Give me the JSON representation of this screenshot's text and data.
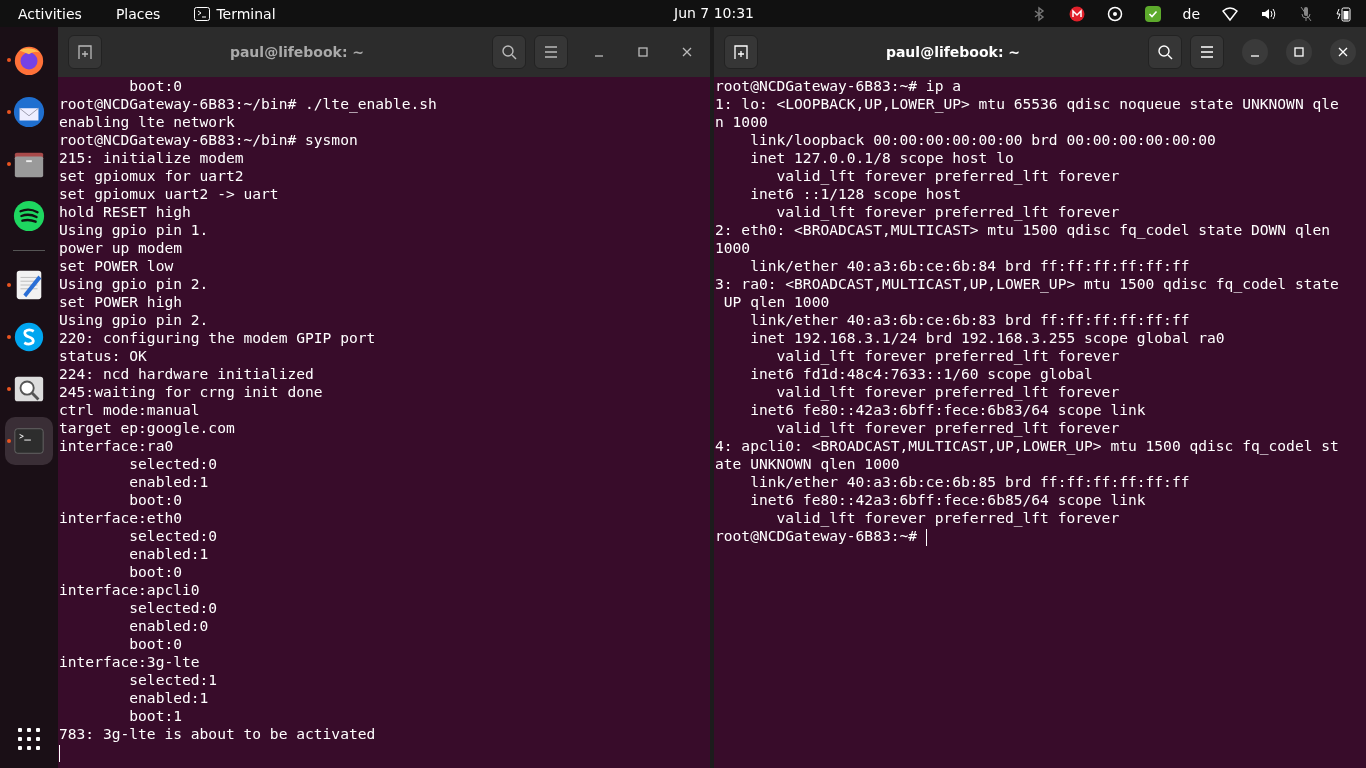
{
  "top_bar": {
    "activities": "Activities",
    "places": "Places",
    "app_menu": "Terminal",
    "clock": "Jun 7  10:31",
    "keyboard_layout": "de"
  },
  "dock": {
    "favorites": [
      {
        "kind": "firefox",
        "running": true,
        "selected": false
      },
      {
        "kind": "thunderbird",
        "running": true,
        "selected": false
      },
      {
        "kind": "files",
        "running": true,
        "selected": false
      },
      {
        "kind": "spotify",
        "running": false,
        "selected": false
      }
    ],
    "others": [
      {
        "kind": "editor",
        "running": true,
        "selected": false
      },
      {
        "kind": "skype",
        "running": true,
        "selected": false
      },
      {
        "kind": "viewer",
        "running": true,
        "selected": false
      },
      {
        "kind": "terminal",
        "running": true,
        "selected": true
      }
    ]
  },
  "windows": [
    {
      "title": "paul@lifebook: ~",
      "focused": false,
      "lines": [
        "        boot:0",
        "root@NCDGateway-6B83:~/bin# ./lte_enable.sh",
        "enabling lte network",
        "root@NCDGateway-6B83:~/bin# sysmon",
        "215: initialize modem",
        "set gpiomux for uart2",
        "set gpiomux uart2 -> uart",
        "hold RESET high",
        "Using gpio pin 1.",
        "power up modem",
        "set POWER low",
        "Using gpio pin 2.",
        "set POWER high",
        "Using gpio pin 2.",
        "220: configuring the modem GPIP port",
        "status: OK",
        "224: ncd hardware initialized",
        "245:waiting for crng init done",
        "ctrl mode:manual",
        "target ep:google.com",
        "interface:ra0",
        "        selected:0",
        "        enabled:1",
        "        boot:0",
        "interface:eth0",
        "        selected:0",
        "        enabled:1",
        "        boot:0",
        "interface:apcli0",
        "        selected:0",
        "        enabled:0",
        "        boot:0",
        "interface:3g-lte",
        "        selected:1",
        "        enabled:1",
        "        boot:1",
        "783: 3g-lte is about to be activated"
      ]
    },
    {
      "title": "paul@lifebook: ~",
      "focused": true,
      "lines": [
        "root@NCDGateway-6B83:~# ip a",
        "1: lo: <LOOPBACK,UP,LOWER_UP> mtu 65536 qdisc noqueue state UNKNOWN qle",
        "n 1000",
        "    link/loopback 00:00:00:00:00:00 brd 00:00:00:00:00:00",
        "    inet 127.0.0.1/8 scope host lo",
        "       valid_lft forever preferred_lft forever",
        "    inet6 ::1/128 scope host",
        "       valid_lft forever preferred_lft forever",
        "2: eth0: <BROADCAST,MULTICAST> mtu 1500 qdisc fq_codel state DOWN qlen",
        "1000",
        "    link/ether 40:a3:6b:ce:6b:84 brd ff:ff:ff:ff:ff:ff",
        "3: ra0: <BROADCAST,MULTICAST,UP,LOWER_UP> mtu 1500 qdisc fq_codel state",
        " UP qlen 1000",
        "    link/ether 40:a3:6b:ce:6b:83 brd ff:ff:ff:ff:ff:ff",
        "    inet 192.168.3.1/24 brd 192.168.3.255 scope global ra0",
        "       valid_lft forever preferred_lft forever",
        "    inet6 fd1d:48c4:7633::1/60 scope global",
        "       valid_lft forever preferred_lft forever",
        "    inet6 fe80::42a3:6bff:fece:6b83/64 scope link",
        "       valid_lft forever preferred_lft forever",
        "4: apcli0: <BROADCAST,MULTICAST,UP,LOWER_UP> mtu 1500 qdisc fq_codel st",
        "ate UNKNOWN qlen 1000",
        "    link/ether 40:a3:6b:ce:6b:85 brd ff:ff:ff:ff:ff:ff",
        "    inet6 fe80::42a3:6bff:fece:6b85/64 scope link",
        "       valid_lft forever preferred_lft forever",
        "root@NCDGateway-6B83:~# "
      ]
    }
  ]
}
